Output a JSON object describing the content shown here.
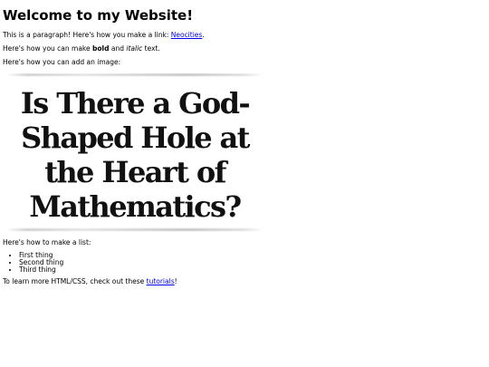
{
  "heading": "Welcome to my Website!",
  "para1": {
    "before": "This is a paragraph! Here's how you make a link: ",
    "link": "Neocities",
    "after": "."
  },
  "para2": {
    "before": "Here's how you can make ",
    "bold": "bold",
    "middle": " and ",
    "italic": "italic",
    "after": " text."
  },
  "para3": "Here's how you can add an image:",
  "image": {
    "lines": [
      "Is There a God-",
      "Shaped Hole at",
      "the Heart of",
      "Mathematics?"
    ]
  },
  "list_intro": "Here's how to make a list:",
  "list_items": [
    "First thing",
    "Second thing",
    "Third thing"
  ],
  "para_last": {
    "before": "To learn more HTML/CSS, check out these ",
    "link": "tutorials",
    "after": "!"
  },
  "colors": {
    "link": "#0000ee",
    "text": "#000000",
    "background": "#ffffff"
  }
}
